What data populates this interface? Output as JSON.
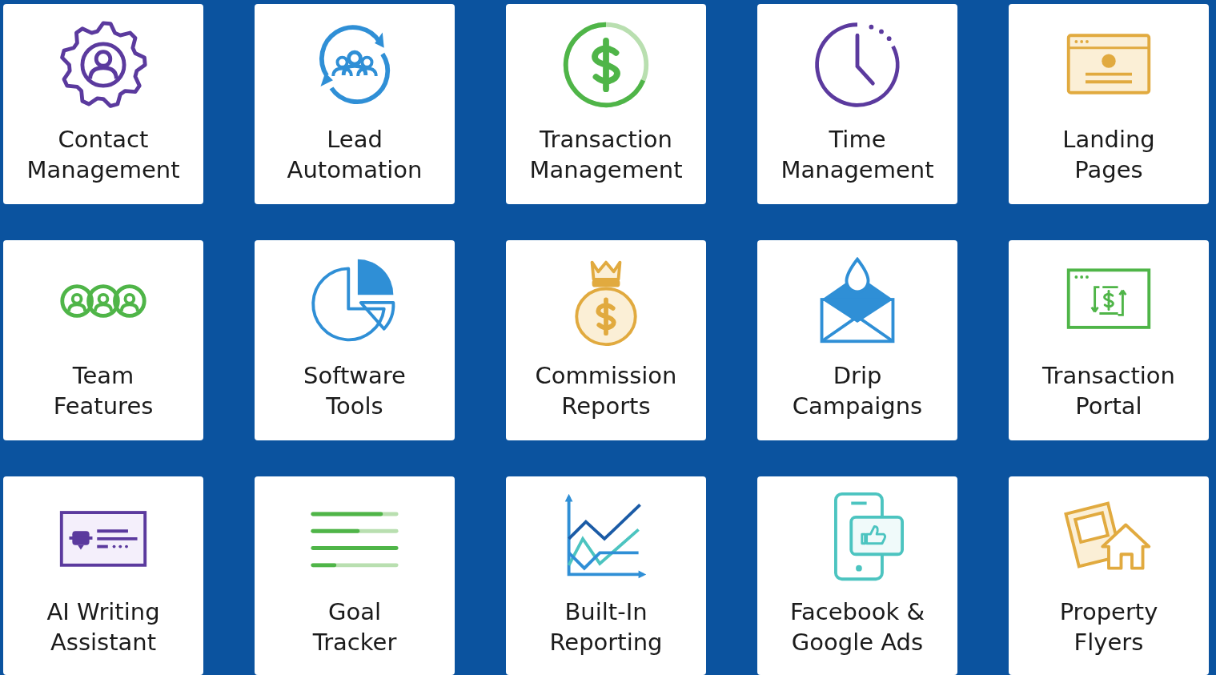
{
  "features": [
    {
      "label": "Contact\nManagement",
      "kind": "gear-person"
    },
    {
      "label": "Lead\nAutomation",
      "kind": "people-cycle"
    },
    {
      "label": "Transaction\nManagement",
      "kind": "dollar-coin"
    },
    {
      "label": "Time\nManagement",
      "kind": "clock"
    },
    {
      "label": "Landing\nPages",
      "kind": "web-page"
    },
    {
      "label": "Team\nFeatures",
      "kind": "people-group"
    },
    {
      "label": "Software\nTools",
      "kind": "pie-chart"
    },
    {
      "label": "Commission\nReports",
      "kind": "money-bag"
    },
    {
      "label": "Drip\nCampaigns",
      "kind": "envelope-drop"
    },
    {
      "label": "Transaction\nPortal",
      "kind": "browser-dollar"
    },
    {
      "label": "AI Writing\nAssistant",
      "kind": "robot-card"
    },
    {
      "label": "Goal\nTracker",
      "kind": "progress-bars"
    },
    {
      "label": "Built-In\nReporting",
      "kind": "line-chart"
    },
    {
      "label": "Facebook &\nGoogle Ads",
      "kind": "phone-thumbs-up"
    },
    {
      "label": "Property\nFlyers",
      "kind": "house-flyer"
    }
  ]
}
